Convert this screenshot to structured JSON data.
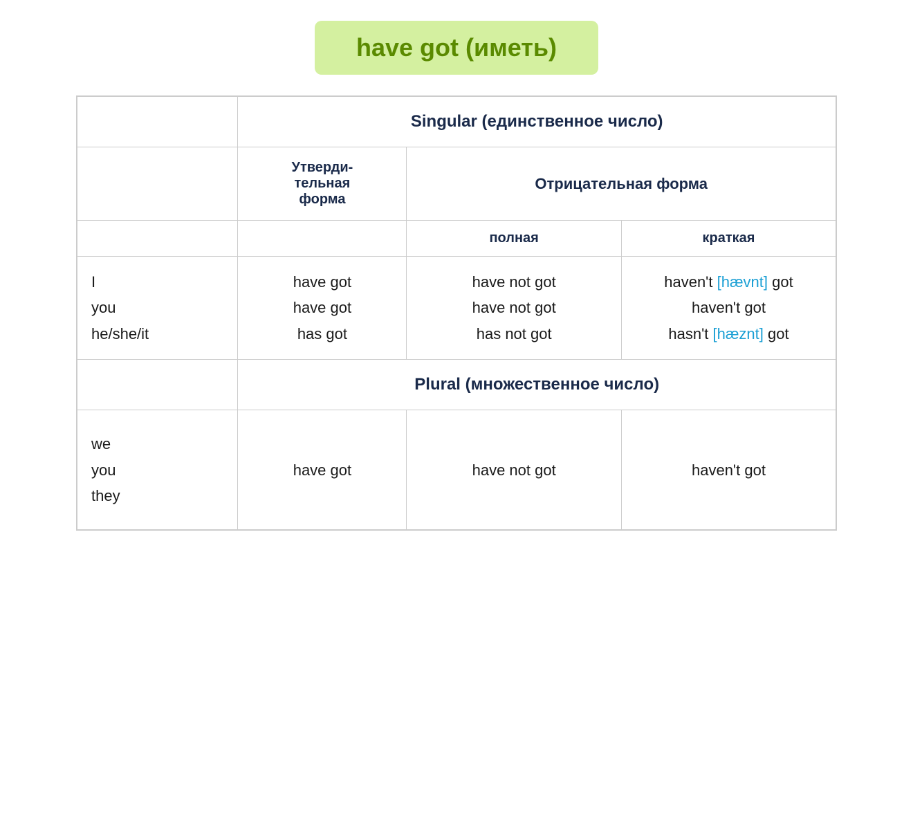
{
  "title": {
    "text": "have got (иметь)"
  },
  "table": {
    "singular_header": "Singular (единственное число)",
    "plural_header": "Plural (множественное число)",
    "positive_header": "Утверди-тельная форма",
    "negative_header": "Отрицательная форма",
    "full_subheader": "полная",
    "short_subheader": "краткая",
    "singular_rows": [
      {
        "pronoun": "I",
        "positive": "have got",
        "negative_full": "have not got",
        "negative_short_prefix": "haven't",
        "negative_short_phonetic": "[hævnt]",
        "negative_short_suffix": "got"
      },
      {
        "pronoun": "you",
        "positive": "have got",
        "negative_full": "have not got",
        "negative_short_prefix": "haven't",
        "negative_short_phonetic": "",
        "negative_short_suffix": "got"
      },
      {
        "pronoun": "he/she/it",
        "positive": "has got",
        "negative_full": "has not got",
        "negative_short_prefix": "hasn't",
        "negative_short_phonetic": "[hæznt]",
        "negative_short_suffix": "got"
      }
    ],
    "plural_pronoun": "we\nyou\nthey",
    "plural_positive": "have got",
    "plural_negative_full": "have not got",
    "plural_negative_short": "haven't got"
  }
}
